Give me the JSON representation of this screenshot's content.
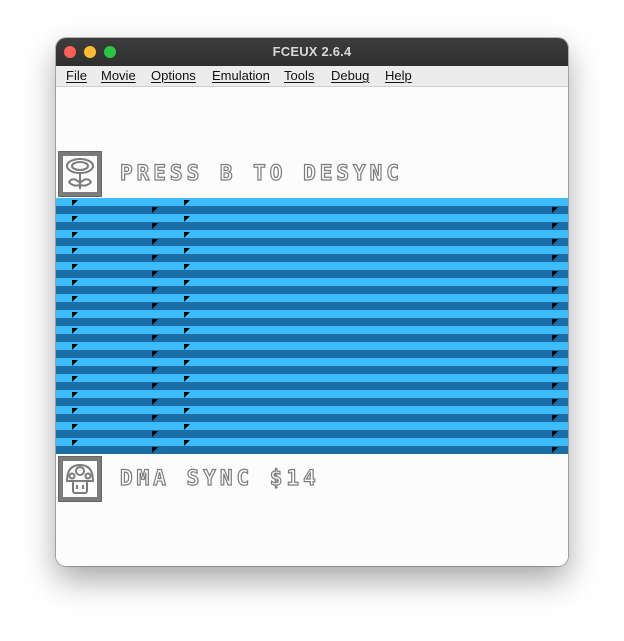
{
  "window": {
    "title": "FCEUX 2.6.4"
  },
  "menu": [
    {
      "label": "File"
    },
    {
      "label": "Movie"
    },
    {
      "label": "Options"
    },
    {
      "label": "Emulation"
    },
    {
      "label": "Tools"
    },
    {
      "label": "Debug"
    },
    {
      "label": "Help"
    }
  ],
  "screen": {
    "top_message": "PRESS B TO DESYNC",
    "bottom_message": "DMA SYNC $14",
    "top_icon": "fire-flower-icon",
    "bottom_icon": "mushroom-icon"
  },
  "colors": {
    "stripe_light": "#3cbcfc",
    "stripe_dark": "#1a6ea8",
    "text_fill": "#fcfcfc",
    "text_outline": "#7c7c7c"
  }
}
